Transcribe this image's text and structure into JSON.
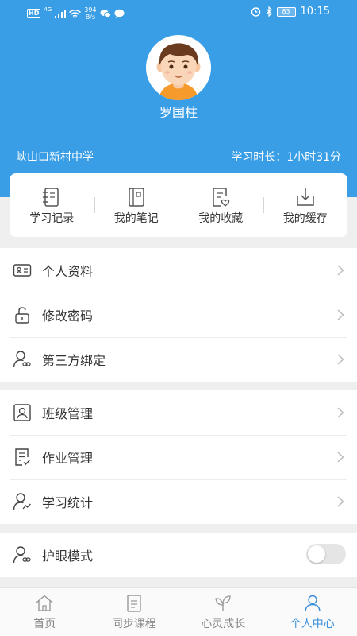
{
  "status_bar": {
    "network_badge": "HD",
    "network_type": "4G",
    "speed_value": "394",
    "speed_unit": "B/s",
    "battery": "83",
    "time": "10:15"
  },
  "profile": {
    "name": "罗国柱",
    "school": "峡山口新村中学",
    "study_time": "学习时长：1小时31分"
  },
  "quick_actions": [
    {
      "label": "学习记录",
      "icon": "notebook-icon"
    },
    {
      "label": "我的笔记",
      "icon": "notes-icon"
    },
    {
      "label": "我的收藏",
      "icon": "favorite-doc-icon"
    },
    {
      "label": "我的缓存",
      "icon": "download-icon"
    }
  ],
  "menu_group_1": [
    {
      "label": "个人资料",
      "icon": "id-card-icon"
    },
    {
      "label": "修改密码",
      "icon": "unlock-icon"
    },
    {
      "label": "第三方绑定",
      "icon": "user-link-icon"
    }
  ],
  "menu_group_2": [
    {
      "label": "班级管理",
      "icon": "class-icon"
    },
    {
      "label": "作业管理",
      "icon": "homework-icon"
    },
    {
      "label": "学习统计",
      "icon": "stats-user-icon"
    }
  ],
  "menu_group_3": [
    {
      "label": "护眼模式",
      "icon": "eye-care-icon",
      "toggle_on": false
    }
  ],
  "tabbar": [
    {
      "label": "首页",
      "icon": "home-icon",
      "active": false
    },
    {
      "label": "同步课程",
      "icon": "course-icon",
      "active": false
    },
    {
      "label": "心灵成长",
      "icon": "leaf-icon",
      "active": false
    },
    {
      "label": "个人中心",
      "icon": "person-icon",
      "active": true
    }
  ],
  "colors": {
    "header_blue": "#3a9ee6",
    "active_tab": "#3a8fd9",
    "background": "#efefef"
  }
}
